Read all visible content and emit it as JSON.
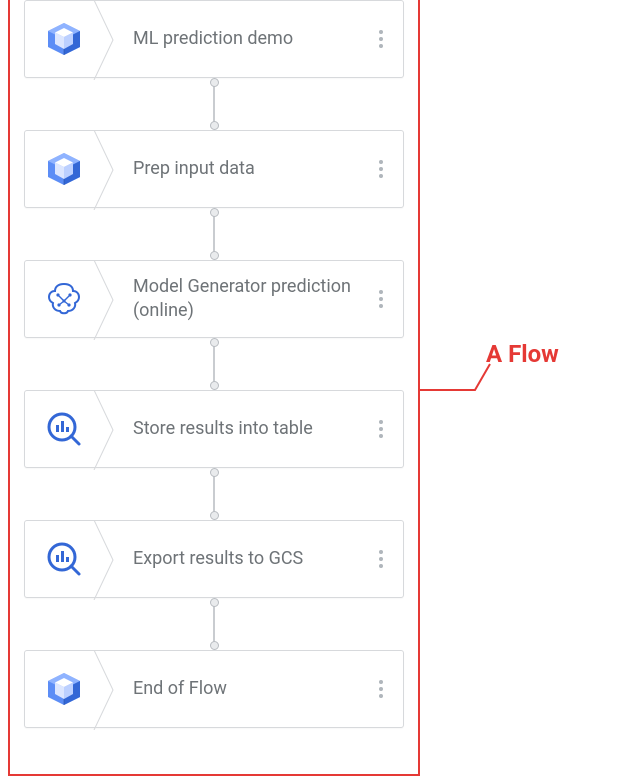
{
  "callout_label": "A Flow",
  "nodes": [
    {
      "label": "ML prediction demo",
      "icon": "cube",
      "icon_name": "cube-icon"
    },
    {
      "label": "Prep input data",
      "icon": "cube",
      "icon_name": "cube-icon"
    },
    {
      "label": "Model Generator prediction (online)",
      "icon": "brain",
      "icon_name": "brain-chip-icon"
    },
    {
      "label": "Store results into table",
      "icon": "lens",
      "icon_name": "query-lens-icon"
    },
    {
      "label": "Export results to GCS",
      "icon": "lens",
      "icon_name": "query-lens-icon"
    },
    {
      "label": "End of Flow",
      "icon": "cube",
      "icon_name": "cube-icon"
    }
  ],
  "colors": {
    "accent_red": "#e53935",
    "icon_blue": "#3367d6",
    "icon_blue_light": "#5c8df6",
    "text_gray": "#6e7377"
  }
}
